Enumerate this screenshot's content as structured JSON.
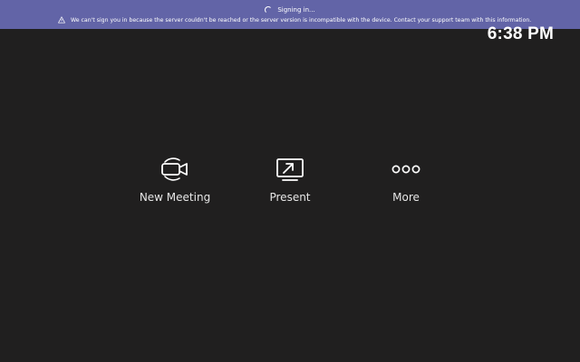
{
  "banner": {
    "status_text": "Signing in...",
    "error_text": "We can't sign you in because the server couldn't be reached or the server version is incompatible with the device. Contact your support team with this information.",
    "color": "#6264a7"
  },
  "clock": {
    "time": "6:38 PM"
  },
  "actions": [
    {
      "label": "New Meeting",
      "icon": "video-camera-icon"
    },
    {
      "label": "Present",
      "icon": "screen-share-icon"
    },
    {
      "label": "More",
      "icon": "more-dots-icon"
    }
  ],
  "theme": {
    "background": "#201f1f",
    "text": "#ffffff"
  }
}
